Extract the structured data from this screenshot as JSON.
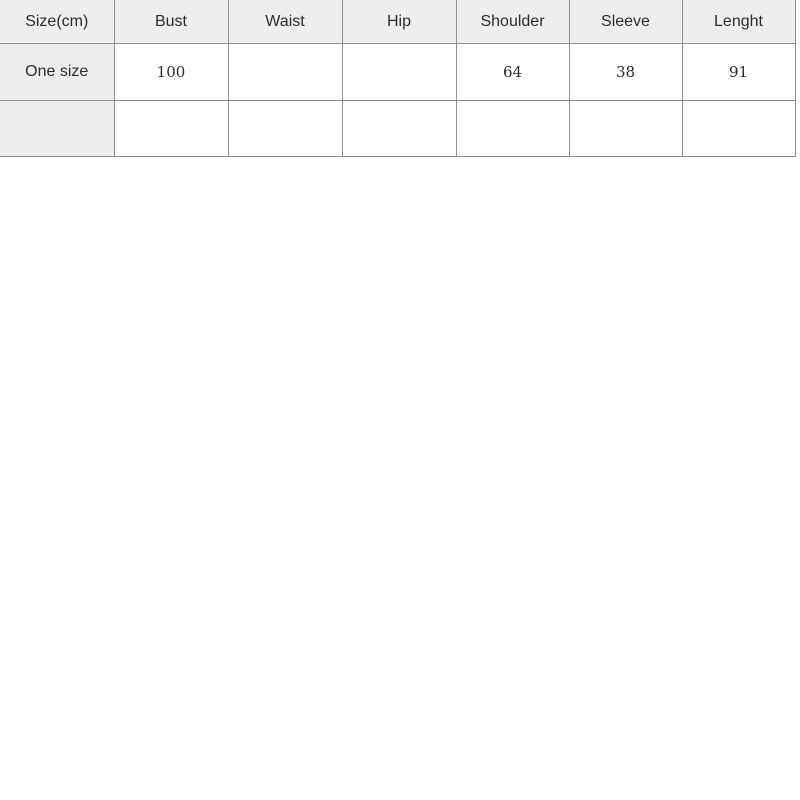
{
  "table": {
    "name": "size-chart",
    "headers": [
      "Size(cm)",
      "Bust",
      "Waist",
      "Hip",
      "Shoulder",
      "Sleeve",
      "Lenght"
    ],
    "rows": [
      {
        "label": "One size",
        "values": [
          "100",
          "",
          "",
          "64",
          "38",
          "91"
        ]
      },
      {
        "label": "",
        "values": [
          "",
          "",
          "",
          "",
          "",
          ""
        ]
      }
    ],
    "colors": {
      "header_background": "#eeeeee",
      "label_background": "#ececec",
      "cell_background": "#ffffff",
      "border": "#8f8f8f",
      "text": "#2b2b2b"
    }
  }
}
